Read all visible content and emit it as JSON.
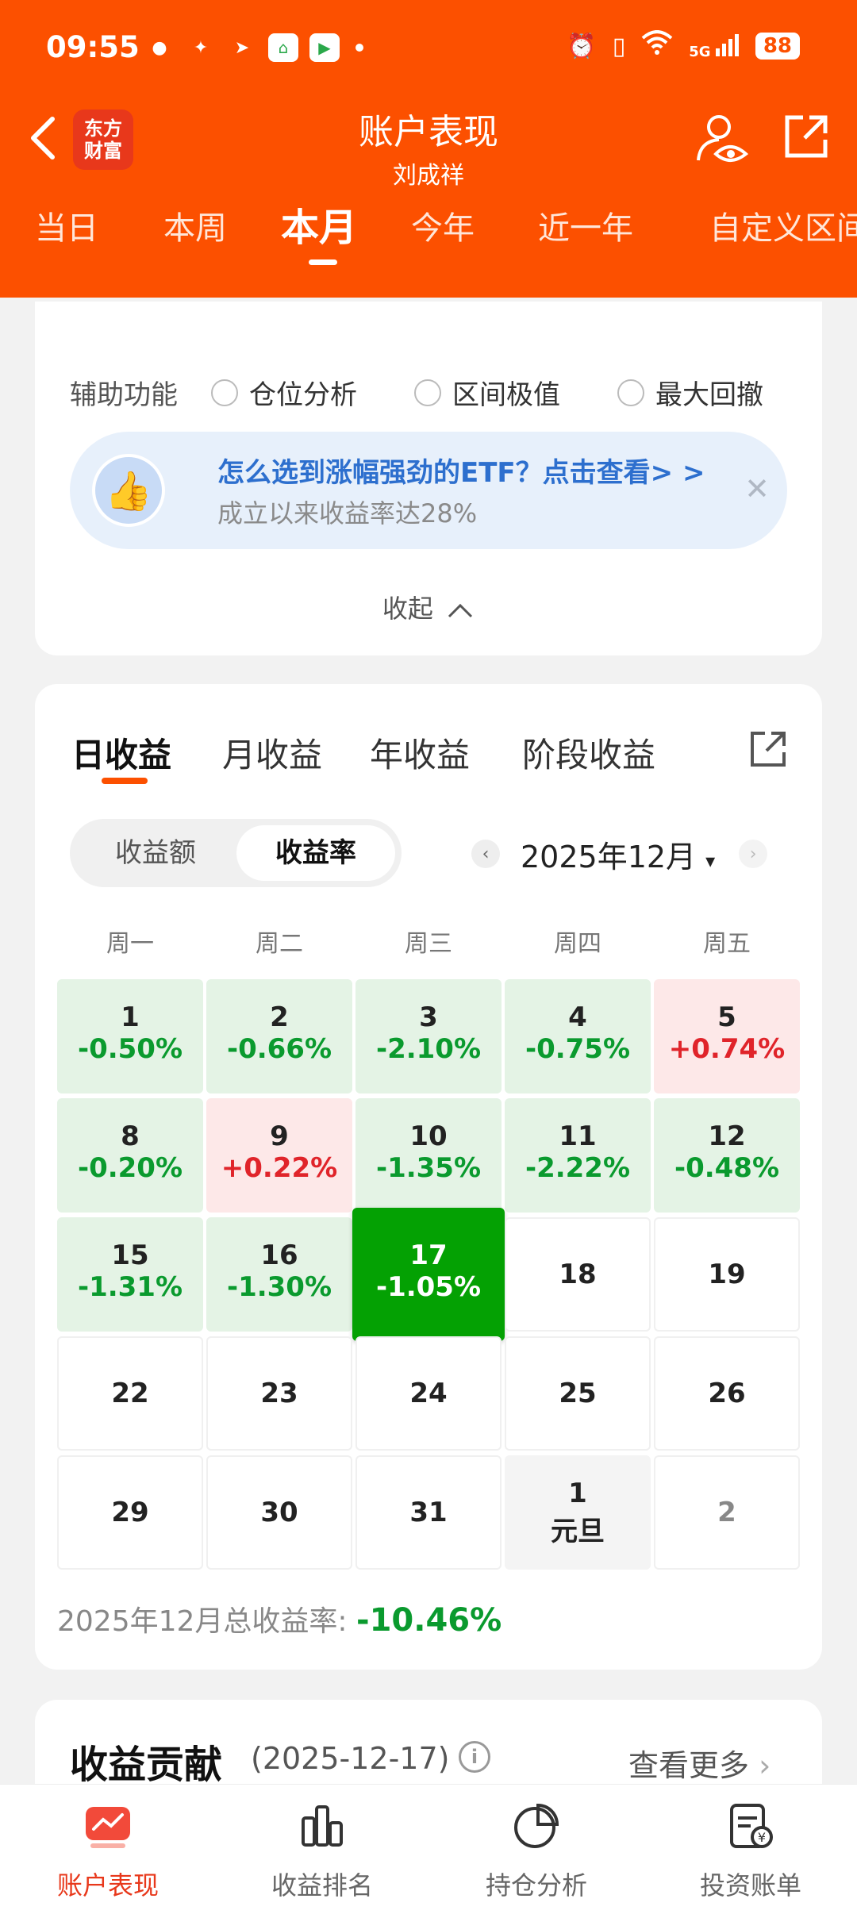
{
  "status": {
    "time": "09:55",
    "battery": "88",
    "network": "5G"
  },
  "nav": {
    "logo": "东方财富",
    "title": "账户表现",
    "subtitle": "刘成祥"
  },
  "period_tabs": [
    "当日",
    "本周",
    "本月",
    "今年",
    "近一年",
    "自定义区间"
  ],
  "active_period": "本月",
  "aux": {
    "label": "辅助功能",
    "options": [
      "仓位分析",
      "区间极值",
      "最大回撤"
    ]
  },
  "promo": {
    "title": "怎么选到涨幅强劲的ETF？点击查看> >",
    "subtitle": "成立以来收益率达28%"
  },
  "collapse_label": "收起",
  "income_tabs": [
    "日收益",
    "月收益",
    "年收益",
    "阶段收益"
  ],
  "segment": [
    "收益额",
    "收益率"
  ],
  "month_label": "2025年12月",
  "weekdays": [
    "周一",
    "周二",
    "周三",
    "周四",
    "周五"
  ],
  "calendar": [
    [
      {
        "day": "1",
        "value": "-0.50%",
        "type": "neg"
      },
      {
        "day": "2",
        "value": "-0.66%",
        "type": "neg"
      },
      {
        "day": "3",
        "value": "-2.10%",
        "type": "neg"
      },
      {
        "day": "4",
        "value": "-0.75%",
        "type": "neg"
      },
      {
        "day": "5",
        "value": "+0.74%",
        "type": "pos"
      }
    ],
    [
      {
        "day": "8",
        "value": "-0.20%",
        "type": "neg"
      },
      {
        "day": "9",
        "value": "+0.22%",
        "type": "pos"
      },
      {
        "day": "10",
        "value": "-1.35%",
        "type": "neg"
      },
      {
        "day": "11",
        "value": "-2.22%",
        "type": "neg"
      },
      {
        "day": "12",
        "value": "-0.48%",
        "type": "neg"
      }
    ],
    [
      {
        "day": "15",
        "value": "-1.31%",
        "type": "neg"
      },
      {
        "day": "16",
        "value": "-1.30%",
        "type": "neg"
      },
      {
        "day": "17",
        "value": "-1.05%",
        "type": "sel"
      },
      {
        "day": "18",
        "value": "",
        "type": "empty"
      },
      {
        "day": "19",
        "value": "",
        "type": "empty"
      }
    ],
    [
      {
        "day": "22",
        "value": "",
        "type": "empty"
      },
      {
        "day": "23",
        "value": "",
        "type": "empty"
      },
      {
        "day": "24",
        "value": "",
        "type": "empty"
      },
      {
        "day": "25",
        "value": "",
        "type": "empty"
      },
      {
        "day": "26",
        "value": "",
        "type": "empty"
      }
    ],
    [
      {
        "day": "29",
        "value": "",
        "type": "empty"
      },
      {
        "day": "30",
        "value": "",
        "type": "empty"
      },
      {
        "day": "31",
        "value": "",
        "type": "empty"
      },
      {
        "day": "1",
        "value": "元旦",
        "type": "holiday"
      },
      {
        "day": "2",
        "value": "",
        "type": "muted"
      }
    ]
  ],
  "total": {
    "label": "2025年12月总收益率: ",
    "value": "-10.46%"
  },
  "contribution": {
    "title": "收益贡献",
    "date": "(2025-12-17)",
    "more": "查看更多"
  },
  "bottom_nav": [
    "账户表现",
    "收益排名",
    "持仓分析",
    "投资账单"
  ],
  "colors": {
    "brand": "#fc5000",
    "down": "#0a9a2e",
    "up": "#e0242a",
    "selected": "#04a103"
  }
}
